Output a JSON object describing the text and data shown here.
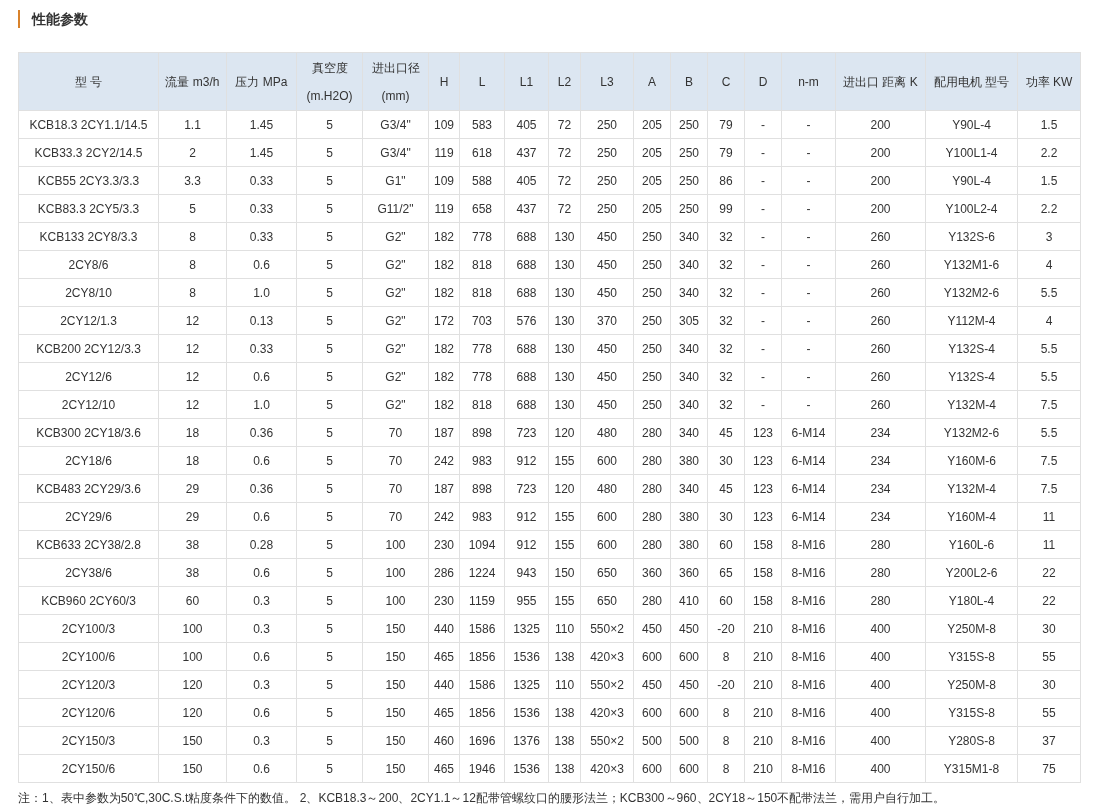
{
  "title": "性能参数",
  "table": {
    "columns": [
      "型 号",
      "流量 m3/h",
      "压力 MPa",
      "真空度\n(m.H2O)",
      "进出口径\n(mm)",
      "H",
      "L",
      "L1",
      "L2",
      "L3",
      "A",
      "B",
      "C",
      "D",
      "n-m",
      "进出口 距离 K",
      "配用电机 型号",
      "功率 KW"
    ],
    "rows": [
      [
        "KCB18.3 2CY1.1/14.5",
        "1.1",
        "1.45",
        "5",
        "G3/4\"",
        "109",
        "583",
        "405",
        "72",
        "250",
        "205",
        "250",
        "79",
        "-",
        "-",
        "200",
        "Y90L-4",
        "1.5"
      ],
      [
        "KCB33.3 2CY2/14.5",
        "2",
        "1.45",
        "5",
        "G3/4\"",
        "119",
        "618",
        "437",
        "72",
        "250",
        "205",
        "250",
        "79",
        "-",
        "-",
        "200",
        "Y100L1-4",
        "2.2"
      ],
      [
        "KCB55 2CY3.3/3.3",
        "3.3",
        "0.33",
        "5",
        "G1\"",
        "109",
        "588",
        "405",
        "72",
        "250",
        "205",
        "250",
        "86",
        "-",
        "-",
        "200",
        "Y90L-4",
        "1.5"
      ],
      [
        "KCB83.3 2CY5/3.3",
        "5",
        "0.33",
        "5",
        "G11/2\"",
        "119",
        "658",
        "437",
        "72",
        "250",
        "205",
        "250",
        "99",
        "-",
        "-",
        "200",
        "Y100L2-4",
        "2.2"
      ],
      [
        "KCB133 2CY8/3.3",
        "8",
        "0.33",
        "5",
        "G2\"",
        "182",
        "778",
        "688",
        "130",
        "450",
        "250",
        "340",
        "32",
        "-",
        "-",
        "260",
        "Y132S-6",
        "3"
      ],
      [
        "2CY8/6",
        "8",
        "0.6",
        "5",
        "G2\"",
        "182",
        "818",
        "688",
        "130",
        "450",
        "250",
        "340",
        "32",
        "-",
        "-",
        "260",
        "Y132M1-6",
        "4"
      ],
      [
        "2CY8/10",
        "8",
        "1.0",
        "5",
        "G2\"",
        "182",
        "818",
        "688",
        "130",
        "450",
        "250",
        "340",
        "32",
        "-",
        "-",
        "260",
        "Y132M2-6",
        "5.5"
      ],
      [
        "2CY12/1.3",
        "12",
        "0.13",
        "5",
        "G2\"",
        "172",
        "703",
        "576",
        "130",
        "370",
        "250",
        "305",
        "32",
        "-",
        "-",
        "260",
        "Y112M-4",
        "4"
      ],
      [
        "KCB200 2CY12/3.3",
        "12",
        "0.33",
        "5",
        "G2\"",
        "182",
        "778",
        "688",
        "130",
        "450",
        "250",
        "340",
        "32",
        "-",
        "-",
        "260",
        "Y132S-4",
        "5.5"
      ],
      [
        "2CY12/6",
        "12",
        "0.6",
        "5",
        "G2\"",
        "182",
        "778",
        "688",
        "130",
        "450",
        "250",
        "340",
        "32",
        "-",
        "-",
        "260",
        "Y132S-4",
        "5.5"
      ],
      [
        "2CY12/10",
        "12",
        "1.0",
        "5",
        "G2\"",
        "182",
        "818",
        "688",
        "130",
        "450",
        "250",
        "340",
        "32",
        "-",
        "-",
        "260",
        "Y132M-4",
        "7.5"
      ],
      [
        "KCB300 2CY18/3.6",
        "18",
        "0.36",
        "5",
        "70",
        "187",
        "898",
        "723",
        "120",
        "480",
        "280",
        "340",
        "45",
        "123",
        "6-M14",
        "234",
        "Y132M2-6",
        "5.5"
      ],
      [
        "2CY18/6",
        "18",
        "0.6",
        "5",
        "70",
        "242",
        "983",
        "912",
        "155",
        "600",
        "280",
        "380",
        "30",
        "123",
        "6-M14",
        "234",
        "Y160M-6",
        "7.5"
      ],
      [
        "KCB483 2CY29/3.6",
        "29",
        "0.36",
        "5",
        "70",
        "187",
        "898",
        "723",
        "120",
        "480",
        "280",
        "340",
        "45",
        "123",
        "6-M14",
        "234",
        "Y132M-4",
        "7.5"
      ],
      [
        "2CY29/6",
        "29",
        "0.6",
        "5",
        "70",
        "242",
        "983",
        "912",
        "155",
        "600",
        "280",
        "380",
        "30",
        "123",
        "6-M14",
        "234",
        "Y160M-4",
        "11"
      ],
      [
        "KCB633 2CY38/2.8",
        "38",
        "0.28",
        "5",
        "100",
        "230",
        "1094",
        "912",
        "155",
        "600",
        "280",
        "380",
        "60",
        "158",
        "8-M16",
        "280",
        "Y160L-6",
        "11"
      ],
      [
        "2CY38/6",
        "38",
        "0.6",
        "5",
        "100",
        "286",
        "1224",
        "943",
        "150",
        "650",
        "360",
        "360",
        "65",
        "158",
        "8-M16",
        "280",
        "Y200L2-6",
        "22"
      ],
      [
        "KCB960 2CY60/3",
        "60",
        "0.3",
        "5",
        "100",
        "230",
        "1159",
        "955",
        "155",
        "650",
        "280",
        "410",
        "60",
        "158",
        "8-M16",
        "280",
        "Y180L-4",
        "22"
      ],
      [
        "2CY100/3",
        "100",
        "0.3",
        "5",
        "150",
        "440",
        "1586",
        "1325",
        "110",
        "550×2",
        "450",
        "450",
        "-20",
        "210",
        "8-M16",
        "400",
        "Y250M-8",
        "30"
      ],
      [
        "2CY100/6",
        "100",
        "0.6",
        "5",
        "150",
        "465",
        "1856",
        "1536",
        "138",
        "420×3",
        "600",
        "600",
        "8",
        "210",
        "8-M16",
        "400",
        "Y315S-8",
        "55"
      ],
      [
        "2CY120/3",
        "120",
        "0.3",
        "5",
        "150",
        "440",
        "1586",
        "1325",
        "110",
        "550×2",
        "450",
        "450",
        "-20",
        "210",
        "8-M16",
        "400",
        "Y250M-8",
        "30"
      ],
      [
        "2CY120/6",
        "120",
        "0.6",
        "5",
        "150",
        "465",
        "1856",
        "1536",
        "138",
        "420×3",
        "600",
        "600",
        "8",
        "210",
        "8-M16",
        "400",
        "Y315S-8",
        "55"
      ],
      [
        "2CY150/3",
        "150",
        "0.3",
        "5",
        "150",
        "460",
        "1696",
        "1376",
        "138",
        "550×2",
        "500",
        "500",
        "8",
        "210",
        "8-M16",
        "400",
        "Y280S-8",
        "37"
      ],
      [
        "2CY150/6",
        "150",
        "0.6",
        "5",
        "150",
        "465",
        "1946",
        "1536",
        "138",
        "420×3",
        "600",
        "600",
        "8",
        "210",
        "8-M16",
        "400",
        "Y315M1-8",
        "75"
      ]
    ]
  },
  "note": "注：1、表中参数为50℃,30C.S.t粘度条件下的数值。 2、KCB18.3～200、2CY1.1～12配带管螺纹口的腰形法兰；KCB300～960、2CY18～150不配带法兰，需用户自行加工。"
}
